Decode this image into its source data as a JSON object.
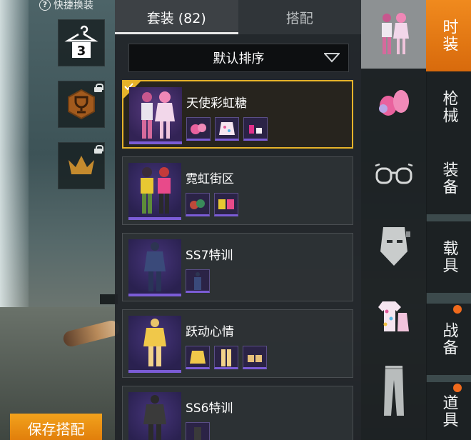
{
  "quick_swap": {
    "label": "快捷换装"
  },
  "tabs": [
    {
      "label": "套装 (82)",
      "active": true
    },
    {
      "label": "搭配",
      "active": false
    }
  ],
  "sort": {
    "label": "默认排序"
  },
  "outfits": [
    {
      "name": "天使彩虹糖",
      "selected": true,
      "parts": 3
    },
    {
      "name": "霓虹街区",
      "selected": false,
      "parts": 2
    },
    {
      "name": "SS7特训",
      "selected": false,
      "parts": 1
    },
    {
      "name": "跃动心情",
      "selected": false,
      "parts": 3
    },
    {
      "name": "SS6特训",
      "selected": false,
      "parts": 1
    }
  ],
  "categories": [
    {
      "icon": "outfit-icon",
      "active": true
    },
    {
      "icon": "hair-icon",
      "active": false
    },
    {
      "icon": "glasses-icon",
      "active": false
    },
    {
      "icon": "mask-icon",
      "active": false
    },
    {
      "icon": "top-icon",
      "active": false
    },
    {
      "icon": "pants-icon",
      "active": false
    }
  ],
  "vertical_tabs": [
    {
      "label": "时装",
      "active": true,
      "dot": false
    },
    {
      "label": "枪械",
      "active": false,
      "dot": false
    },
    {
      "label": "装备",
      "active": false,
      "dot": false
    },
    {
      "label": "载具",
      "active": false,
      "dot": false
    },
    {
      "label": "战备",
      "active": false,
      "dot": true
    },
    {
      "label": "道具",
      "active": false,
      "dot": true
    }
  ],
  "quick_slots": [
    {
      "icon": "hanger-icon",
      "badge": "3",
      "locked": false
    },
    {
      "icon": "trophy-icon",
      "locked": true
    },
    {
      "icon": "crown-icon",
      "locked": true
    }
  ],
  "save_button": {
    "label": "保存搭配"
  },
  "colors": {
    "accent": "#f08a1e",
    "selected_border": "#e6b32a",
    "rarity": "#7b5cd6"
  }
}
